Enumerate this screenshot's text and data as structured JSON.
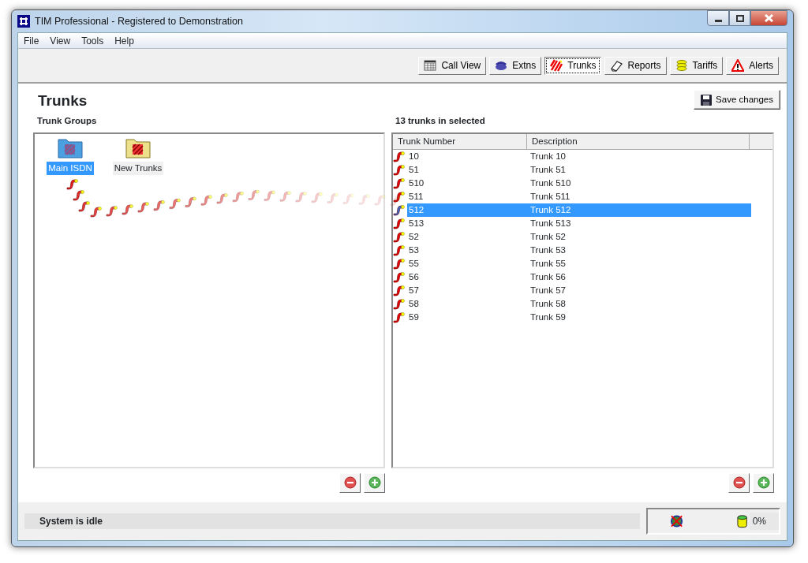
{
  "window": {
    "title": "TIM Professional - Registered to Demonstration"
  },
  "menu": [
    "File",
    "View",
    "Tools",
    "Help"
  ],
  "toolbar": [
    {
      "label": "Call View",
      "kind": "grid",
      "selected": false
    },
    {
      "label": "Extns",
      "kind": "phone",
      "selected": false
    },
    {
      "label": "Trunks",
      "kind": "trunks",
      "selected": true
    },
    {
      "label": "Reports",
      "kind": "reports",
      "selected": false
    },
    {
      "label": "Tariffs",
      "kind": "coins",
      "selected": false
    },
    {
      "label": "Alerts",
      "kind": "alert",
      "selected": false
    }
  ],
  "page_title": "Trunks",
  "save_button": "Save changes",
  "groups": {
    "heading": "Trunk Groups",
    "items": [
      {
        "label": "Main ISDN",
        "selected": true
      },
      {
        "label": "New Trunks",
        "selected": false
      }
    ]
  },
  "trunks": {
    "heading": "13 trunks in selected",
    "columns": [
      "Trunk Number",
      "Description"
    ],
    "rows": [
      {
        "number": "10",
        "description": "Trunk 10",
        "selected": false
      },
      {
        "number": "51",
        "description": "Trunk 51",
        "selected": false
      },
      {
        "number": "510",
        "description": "Trunk 510",
        "selected": false
      },
      {
        "number": "511",
        "description": "Trunk 511",
        "selected": false
      },
      {
        "number": "512",
        "description": "Trunk 512",
        "selected": true
      },
      {
        "number": "513",
        "description": "Trunk 513",
        "selected": false
      },
      {
        "number": "52",
        "description": "Trunk 52",
        "selected": false
      },
      {
        "number": "53",
        "description": "Trunk 53",
        "selected": false
      },
      {
        "number": "55",
        "description": "Trunk 55",
        "selected": false
      },
      {
        "number": "56",
        "description": "Trunk 56",
        "selected": false
      },
      {
        "number": "57",
        "description": "Trunk 57",
        "selected": false
      },
      {
        "number": "58",
        "description": "Trunk 58",
        "selected": false
      },
      {
        "number": "59",
        "description": "Trunk 59",
        "selected": false
      }
    ]
  },
  "status_bar": {
    "message": "System is idle",
    "usage": "0%"
  }
}
